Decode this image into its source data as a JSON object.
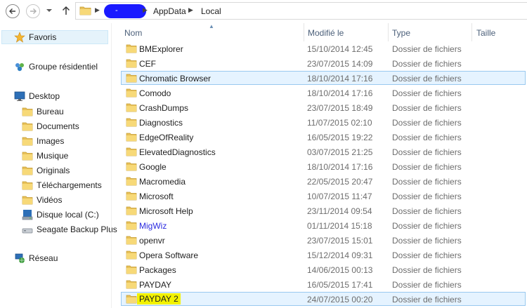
{
  "address_bar": {
    "path": [
      "AppData",
      "Local"
    ]
  },
  "sidebar": {
    "favorites": "Favoris",
    "homegroup": "Groupe résidentiel",
    "desktop": "Desktop",
    "items": [
      {
        "label": "Bureau",
        "icon": "folder-icon"
      },
      {
        "label": "Documents",
        "icon": "folder-icon"
      },
      {
        "label": "Images",
        "icon": "folder-icon"
      },
      {
        "label": "Musique",
        "icon": "folder-icon"
      },
      {
        "label": "Originals",
        "icon": "folder-icon"
      },
      {
        "label": "Téléchargements",
        "icon": "folder-icon"
      },
      {
        "label": "Vidéos",
        "icon": "folder-icon"
      },
      {
        "label": "Disque local (C:)",
        "icon": "drive-icon"
      },
      {
        "label": "Seagate Backup Plus",
        "icon": "external-drive-icon"
      }
    ],
    "network": "Réseau"
  },
  "columns": {
    "name": "Nom",
    "modified": "Modifié le",
    "type": "Type",
    "size": "Taille"
  },
  "files": [
    {
      "name": "BMExplorer",
      "date": "15/10/2014 12:45",
      "type": "Dossier de fichiers"
    },
    {
      "name": "CEF",
      "date": "23/07/2015 14:09",
      "type": "Dossier de fichiers"
    },
    {
      "name": "Chromatic Browser",
      "date": "18/10/2014 17:16",
      "type": "Dossier de fichiers"
    },
    {
      "name": "Comodo",
      "date": "18/10/2014 17:16",
      "type": "Dossier de fichiers"
    },
    {
      "name": "CrashDumps",
      "date": "23/07/2015 18:49",
      "type": "Dossier de fichiers"
    },
    {
      "name": "Diagnostics",
      "date": "11/07/2015 02:10",
      "type": "Dossier de fichiers"
    },
    {
      "name": "EdgeOfReality",
      "date": "16/05/2015 19:22",
      "type": "Dossier de fichiers"
    },
    {
      "name": "ElevatedDiagnostics",
      "date": "03/07/2015 21:25",
      "type": "Dossier de fichiers"
    },
    {
      "name": "Google",
      "date": "18/10/2014 17:16",
      "type": "Dossier de fichiers"
    },
    {
      "name": "Macromedia",
      "date": "22/05/2015 20:47",
      "type": "Dossier de fichiers"
    },
    {
      "name": "Microsoft",
      "date": "10/07/2015 11:47",
      "type": "Dossier de fichiers"
    },
    {
      "name": "Microsoft Help",
      "date": "23/11/2014 09:54",
      "type": "Dossier de fichiers"
    },
    {
      "name": "MigWiz",
      "date": "01/11/2014 15:18",
      "type": "Dossier de fichiers"
    },
    {
      "name": "openvr",
      "date": "23/07/2015 15:01",
      "type": "Dossier de fichiers"
    },
    {
      "name": "Opera Software",
      "date": "15/12/2014 09:31",
      "type": "Dossier de fichiers"
    },
    {
      "name": "Packages",
      "date": "14/06/2015 00:13",
      "type": "Dossier de fichiers"
    },
    {
      "name": "PAYDAY",
      "date": "16/05/2015 17:41",
      "type": "Dossier de fichiers"
    },
    {
      "name": "PAYDAY 2",
      "date": "24/07/2015 00:20",
      "type": "Dossier de fichiers"
    }
  ],
  "colors": {
    "selection_fill": "#e5f3ff",
    "selection_border": "#99c9ef",
    "highlight_yellow": "#f2f200",
    "header_text": "#4c607a",
    "compressed_name_blue": "#2a2ae0"
  }
}
